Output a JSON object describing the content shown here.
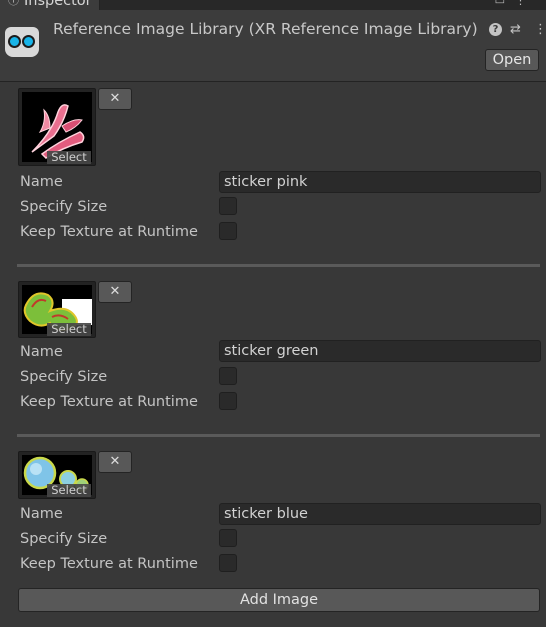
{
  "tab": {
    "icon": "info-icon",
    "title": "Inspector",
    "tools": [
      "lock-icon",
      "more-icon"
    ]
  },
  "header": {
    "icon": "xr-headset-icon",
    "title": "Reference Image Library (XR Reference Image Library)",
    "help_icon": "help-icon",
    "preset_icon": "preset-icon",
    "more_icon": "more-icon",
    "open_label": "Open"
  },
  "labels": {
    "select": "Select",
    "remove": "✕",
    "name": "Name",
    "specify_size": "Specify Size",
    "keep_texture": "Keep Texture at Runtime"
  },
  "images": [
    {
      "name": "sticker pink",
      "specify_size": false,
      "keep_texture": false,
      "thumbnail": "pink-flower-sticker"
    },
    {
      "name": "sticker green",
      "specify_size": false,
      "keep_texture": false,
      "thumbnail": "green-swirl-sticker"
    },
    {
      "name": "sticker blue",
      "specify_size": false,
      "keep_texture": false,
      "thumbnail": "blue-bubble-sticker"
    }
  ],
  "add_image_label": "Add Image",
  "colors": {
    "background": "#383838",
    "header": "#3c3c3c",
    "field": "#2a2a2a",
    "button": "#585858",
    "xr_lens": "#18b4e8"
  }
}
